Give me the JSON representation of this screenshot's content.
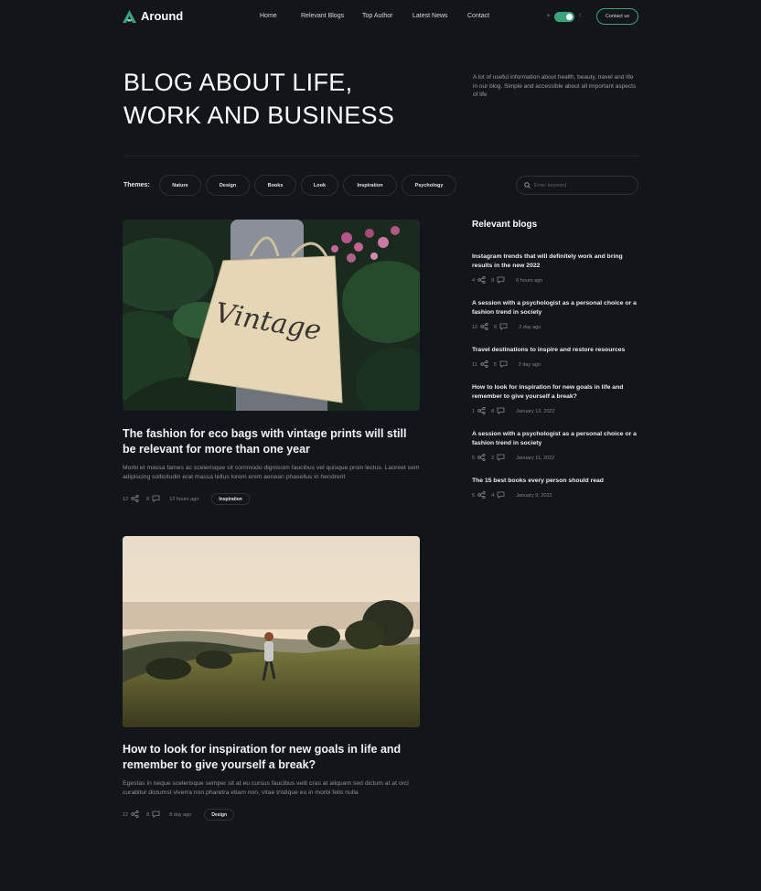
{
  "brand": {
    "name": "Around"
  },
  "nav": [
    {
      "label": "Home"
    },
    {
      "label": "Relevant Blogs"
    },
    {
      "label": "Top Author"
    },
    {
      "label": "Latest News"
    },
    {
      "label": "Contact"
    }
  ],
  "header": {
    "contact_button": "Contact us",
    "theme_toggle_on": true
  },
  "hero": {
    "title_line1": "BLOG ABOUT LIFE,",
    "title_line2": "WORK AND BUSINESS",
    "description": "A lot of useful information about health, beauty, travel and life in our blog. Simple and accessible about all important aspects of life"
  },
  "themes": {
    "label": "Themes:",
    "items": [
      "Nature",
      "Design",
      "Books",
      "Look",
      "Inspiration",
      "Psychology"
    ]
  },
  "search": {
    "placeholder": "Enter keyword"
  },
  "posts": [
    {
      "title": "The fashion for eco bags with vintage prints will still be relevant for more than one year",
      "excerpt": "Morbi et massa fames ac scelerisque sit commodo dignissim faucibus vel quisque proin lectus. Laoreet sem adipiscing sollicitudin erat massa tellus lorem enim aenean phasellus in hendrerit",
      "shares": "12",
      "comments": "8",
      "date": "12 hours ago",
      "tag": "Inspiration",
      "image_text": "Vintage"
    },
    {
      "title": "How to look for inspiration for new goals in life and remember to give yourself a break?",
      "excerpt": "Egestas in neque scelerisque semper sit at eu cursus faucibus velit cras at aliquam sed dictum at at orci curabitur dictumst viverra non pharetra etiam non, vitae tristique eu in morbi felis nulla",
      "shares": "12",
      "comments": "8",
      "date": "8 day ago",
      "tag": "Design"
    }
  ],
  "sidebar": {
    "title": "Relevant blogs",
    "items": [
      {
        "title": "Instagram trends that will definitely work and bring results in the new 2022",
        "shares": "4",
        "comments": "8",
        "date": "6 hours ago"
      },
      {
        "title": "A session with a psychologist as a personal choice or a fashion trend in society",
        "shares": "12",
        "comments": "6",
        "date": "2 day ago"
      },
      {
        "title": "Travel destinations to inspire and restore resources",
        "shares": "11",
        "comments": "5",
        "date": "2 day ago"
      },
      {
        "title": "How to look for inspiration for new goals in life and remember to give yourself a break?",
        "shares": "1",
        "comments": "8",
        "date": "January 13, 2022"
      },
      {
        "title": "A session with a psychologist as a personal choice or a fashion trend in society",
        "shares": "5",
        "comments": "2",
        "date": "January 11, 2022"
      },
      {
        "title": "The 15 best books every person should read",
        "shares": "5",
        "comments": "4",
        "date": "January 9, 2022"
      }
    ]
  },
  "icons": {
    "share": "share-icon",
    "comment": "comment-icon",
    "search": "search-icon",
    "sun": "sun-icon",
    "moon": "moon-icon"
  },
  "colors": {
    "background": "#121519",
    "accent": "#3ba37a",
    "text": "#e8e9ec",
    "muted": "#80848c"
  }
}
